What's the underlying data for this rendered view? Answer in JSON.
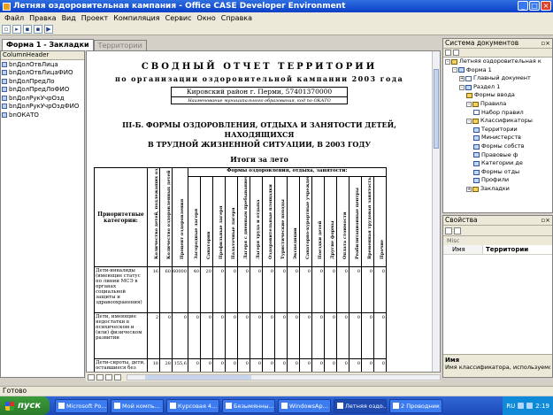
{
  "window": {
    "title": "Летняя оздоровительная кампания - Office CASE Developer Environment"
  },
  "menu": [
    "Файл",
    "Правка",
    "Вид",
    "Проект",
    "Компиляция",
    "Сервис",
    "Окно",
    "Справка"
  ],
  "toolbar_icons": [
    "new-icon",
    "open-icon",
    "save-icon",
    "save-all-icon",
    "run-icon"
  ],
  "doc_tabs": [
    {
      "label": "Форма 1 - Закладки",
      "active": true
    },
    {
      "label": "Территории",
      "active": false
    }
  ],
  "left_panel": {
    "header": "ColumnHeader",
    "fields": [
      "bnДолОтвЛица",
      "bnДолОтвЛицаФИО",
      "bnДолПредЛо",
      "bnДолПредЛоФИО",
      "bnДолРукУчрОзд",
      "bnДолРукУчрОздФИО",
      "bnОКАТО"
    ]
  },
  "report": {
    "title_line1": "СВОДНЫЙ ОТЧЕТ ТЕРРИТОРИИ",
    "title_line2": "по организации оздоровительной кампании 2003 года",
    "district": "Кировский район г. Перми, 57401370000",
    "district_caption": "Наименование муниципального образования, код по ОКАТО",
    "section_line1": "III-Б. ФОРМЫ ОЗДОРОВЛЕНИЯ, ОТДЫХА И ЗАНЯТОСТИ ДЕТЕЙ,",
    "section_line2": "НАХОДЯЩИХСЯ",
    "section_line3": "В ТРУДНОЙ ЖИЗНЕННОЙ СИТУАЦИИ, В 2003 ГОДУ",
    "subtitle": "Итоги за лето",
    "table": {
      "category_header": "Приоритетные категории:",
      "group_header": "Формы оздоровления, отдыха, занятости:",
      "col_headers": [
        "Количество детей, подлежащих оздоровлению (от 6 до 18 лет)",
        "Количество оздоровленных детей",
        "Процент оздоровления",
        "Загородные лагеря",
        "Санатории",
        "Профильные лагеря",
        "Палаточные лагеря",
        "Лагеря с дневным пребыванием",
        "Лагеря труда и отдыха",
        "Оздоровительные площадки",
        "Туристические походы",
        "Экспедиции",
        "Санаторно-курортные учреждения",
        "Поездки детей",
        "Другие формы",
        "Оплата стоимости",
        "Реабилитационные центры",
        "Временная трудовая занятость",
        "Прочие"
      ],
      "rows": [
        {
          "category": "Дети-инвалиды (имеющие статус по линии МСЭ в органах социальной защиты и здравоохранения)",
          "values": [
            "16",
            "60",
            "60000",
            "40",
            "20",
            "0",
            "0",
            "0",
            "0",
            "0",
            "0",
            "0",
            "0",
            "0",
            "0",
            "0",
            "0",
            "0",
            "0"
          ]
        },
        {
          "category": "Дети, имеющие недостатки в психическом и (или) физическом развитии",
          "values": [
            "2",
            "0",
            "0",
            "0",
            "0",
            "0",
            "0",
            "0",
            "0",
            "0",
            "0",
            "0",
            "0",
            "0",
            "0",
            "0",
            "0",
            "0",
            "0"
          ]
        },
        {
          "category": "Дети-сироты, дети, оставшиеся без попечения родителей",
          "values": [
            "18",
            "28",
            "155,6",
            "0",
            "0",
            "0",
            "0",
            "0",
            "0",
            "0",
            "0",
            "0",
            "0",
            "0",
            "0",
            "0",
            "0",
            "0",
            "0"
          ]
        }
      ]
    }
  },
  "doc_system": {
    "title": "Система документов",
    "tree": [
      {
        "label": "Летняя оздоровительная к",
        "depth": 0,
        "toggle": "-",
        "icon": "folder"
      },
      {
        "label": "Форма 1",
        "depth": 1,
        "toggle": "-",
        "icon": "form"
      },
      {
        "label": "Главный документ",
        "depth": 2,
        "toggle": "+",
        "icon": "doc"
      },
      {
        "label": "Раздел 1",
        "depth": 2,
        "toggle": "-",
        "icon": "form"
      },
      {
        "label": "Формы ввода",
        "depth": 3,
        "toggle": "",
        "icon": "folder"
      },
      {
        "label": "Правила",
        "depth": 3,
        "toggle": "-",
        "icon": "folder"
      },
      {
        "label": "Набор правил",
        "depth": 4,
        "toggle": "",
        "icon": "doc"
      },
      {
        "label": "Классификаторы",
        "depth": 3,
        "toggle": "-",
        "icon": "folder"
      },
      {
        "label": "Территории",
        "depth": 4,
        "toggle": "",
        "icon": "form"
      },
      {
        "label": "Министерств",
        "depth": 4,
        "toggle": "",
        "icon": "form"
      },
      {
        "label": "Формы собств",
        "depth": 4,
        "toggle": "",
        "icon": "form"
      },
      {
        "label": "Правовые ф",
        "depth": 4,
        "toggle": "",
        "icon": "form"
      },
      {
        "label": "Категории де",
        "depth": 4,
        "toggle": "",
        "icon": "form"
      },
      {
        "label": "Формы отды",
        "depth": 4,
        "toggle": "",
        "icon": "form"
      },
      {
        "label": "Профили",
        "depth": 4,
        "toggle": "",
        "icon": "form"
      },
      {
        "label": "Закладки",
        "depth": 3,
        "toggle": "+",
        "icon": "folder"
      }
    ]
  },
  "properties": {
    "title": "Свойства",
    "section": "Misc",
    "rows": [
      {
        "key": "Имя",
        "value": "Территории"
      }
    ],
    "desc_title": "Имя",
    "desc_text": "Имя классификатора, используемое при связывании с элементами упр..."
  },
  "status": "Готово",
  "taskbar": {
    "start": "пуск",
    "tasks": [
      "Microsoft Po...",
      "Мой компь...",
      "Курсовая 4...",
      "Безымянны...",
      "WindowsAp...",
      "Летняя оздо...",
      "2 Проводник"
    ],
    "active_task": 5,
    "tray_lang": "RU",
    "clock": "2:19"
  }
}
